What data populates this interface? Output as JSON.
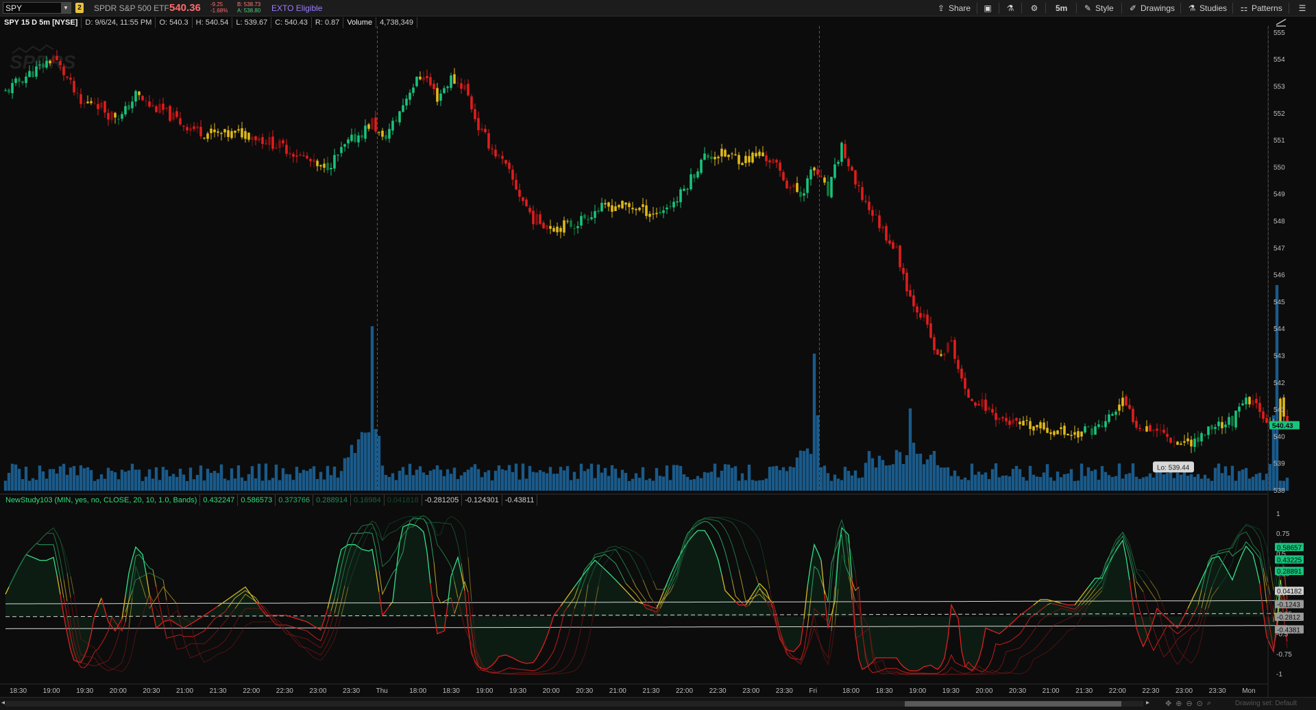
{
  "toolbar": {
    "symbol": "SPY",
    "link_badge": "2",
    "description": "SPDR S&P 500 ETF",
    "last_price": "540.36",
    "net_change": "-9.25",
    "pct_change": "-1.68%",
    "bid": "B: 538.73",
    "ask": "A: 538.80",
    "exto": "EXTO Eligible",
    "buttons": {
      "share": "Share",
      "timeframe": "5m",
      "style": "Style",
      "drawings": "Drawings",
      "studies": "Studies",
      "patterns": "Patterns"
    },
    "icons": [
      "share-icon",
      "notes-icon",
      "flask-icon",
      "gear-icon",
      "style-icon",
      "drawings-icon",
      "studies-icon",
      "patterns-icon",
      "menu-icon"
    ]
  },
  "chart_info": {
    "title": "SPY 15 D 5m [NYSE]",
    "date": "D: 9/6/24, 11:55 PM",
    "open": "O: 540.3",
    "high": "H: 540.54",
    "low": "L: 539.67",
    "close": "C: 540.43",
    "range": "R: 0.87",
    "volume_label": "Volume",
    "volume_value": "4,738,349"
  },
  "price_axis": {
    "ticks": [
      "555",
      "554",
      "553",
      "552",
      "551",
      "550",
      "549",
      "548",
      "547",
      "546",
      "545",
      "544",
      "543",
      "542",
      "541",
      "540",
      "539",
      "538"
    ],
    "current_price_tag": "540.43",
    "low_label": "Lo: 539.44"
  },
  "study": {
    "name": "NewStudy103 (MIN, yes, no, CLOSE, 20, 10, 1.0, Bands)",
    "values": [
      "0.432247",
      "0.586573",
      "0.373766",
      "0.288914",
      "0.16984",
      "0.041818",
      "-0.281205",
      "-0.124301",
      "-0.43811"
    ],
    "axis_ticks": [
      "1",
      "0.75",
      "0.5",
      "0.25",
      "0",
      "-0.25",
      "-0.5",
      "-0.75",
      "-1"
    ],
    "tags": [
      "0.58657",
      "0.43225",
      "0.28891",
      "0.04182",
      "-0.1243",
      "-0.2812",
      "-0.4381"
    ]
  },
  "time_axis": {
    "labels": [
      "18:30",
      "19:00",
      "19:30",
      "20:00",
      "20:30",
      "21:00",
      "21:30",
      "22:00",
      "22:30",
      "23:00",
      "23:30",
      "Thu",
      "18:00",
      "18:30",
      "19:00",
      "19:30",
      "20:00",
      "20:30",
      "21:00",
      "21:30",
      "22:00",
      "22:30",
      "23:00",
      "23:30",
      "Fri",
      "18:00",
      "18:30",
      "19:00",
      "19:30",
      "20:00",
      "20:30",
      "21:00",
      "21:30",
      "22:00",
      "22:30",
      "23:00",
      "23:30",
      "Mon"
    ]
  },
  "footer": {
    "drawing_set": "Drawing set: Default"
  },
  "colors": {
    "up_strong": "#19c37d",
    "up_weak": "#0f7a3c",
    "down_strong": "#e11d1d",
    "down_weak": "#8a1010",
    "neutral": "#e0b81a",
    "volume": "#1a5a8a",
    "accent_last": "#ff6b6b"
  },
  "chart_data": {
    "type": "candlestick",
    "symbol": "SPY",
    "aggregation": "5m",
    "ylim": [
      538,
      555.2
    ],
    "price_path": [
      [
        0,
        552.8
      ],
      [
        6,
        553.4
      ],
      [
        10,
        553.7
      ],
      [
        14,
        554.1
      ],
      [
        18,
        553.3
      ],
      [
        22,
        552.3
      ],
      [
        26,
        552.5
      ],
      [
        30,
        552.0
      ],
      [
        34,
        551.9
      ],
      [
        38,
        552.7
      ],
      [
        42,
        552.3
      ],
      [
        46,
        552.1
      ],
      [
        52,
        551.6
      ],
      [
        58,
        551.3
      ],
      [
        64,
        551.2
      ],
      [
        70,
        551.3
      ],
      [
        76,
        551.0
      ],
      [
        82,
        550.7
      ],
      [
        88,
        550.3
      ],
      [
        92,
        549.9
      ],
      [
        96,
        550.3
      ],
      [
        100,
        550.9
      ],
      [
        104,
        551.3
      ],
      [
        107,
        551.7
      ],
      [
        110,
        551.0
      ],
      [
        114,
        551.8
      ],
      [
        118,
        552.9
      ],
      [
        122,
        553.5
      ],
      [
        126,
        552.6
      ],
      [
        130,
        553.3
      ],
      [
        134,
        553.0
      ],
      [
        138,
        551.5
      ],
      [
        142,
        550.7
      ],
      [
        146,
        550.0
      ],
      [
        150,
        549.0
      ],
      [
        154,
        548.1
      ],
      [
        160,
        547.8
      ],
      [
        166,
        547.9
      ],
      [
        172,
        548.4
      ],
      [
        178,
        548.6
      ],
      [
        184,
        548.5
      ],
      [
        190,
        548.3
      ],
      [
        196,
        548.8
      ],
      [
        200,
        549.6
      ],
      [
        204,
        550.4
      ],
      [
        208,
        550.5
      ],
      [
        212,
        550.4
      ],
      [
        216,
        550.3
      ],
      [
        220,
        550.5
      ],
      [
        224,
        550.2
      ],
      [
        228,
        549.4
      ],
      [
        232,
        549.0
      ],
      [
        236,
        550.0
      ],
      [
        240,
        549.0
      ],
      [
        244,
        550.8
      ],
      [
        248,
        549.3
      ],
      [
        252,
        548.5
      ],
      [
        256,
        547.7
      ],
      [
        260,
        546.9
      ],
      [
        264,
        545.2
      ],
      [
        268,
        544.4
      ],
      [
        272,
        542.9
      ],
      [
        276,
        543.5
      ],
      [
        280,
        541.6
      ],
      [
        284,
        541.3
      ],
      [
        290,
        540.7
      ],
      [
        296,
        540.4
      ],
      [
        304,
        540.3
      ],
      [
        312,
        540.1
      ],
      [
        320,
        540.4
      ],
      [
        326,
        541.3
      ],
      [
        330,
        540.5
      ],
      [
        336,
        540.3
      ],
      [
        342,
        539.8
      ],
      [
        348,
        539.9
      ],
      [
        352,
        540.4
      ],
      [
        358,
        540.6
      ],
      [
        362,
        541.3
      ],
      [
        366,
        541.1
      ],
      [
        370,
        540.2
      ],
      [
        372,
        541.3
      ],
      [
        374,
        540.4
      ]
    ],
    "series": [
      {
        "name": "Volume",
        "type": "bar",
        "note": "spikes at session opens Thu and Fri"
      }
    ]
  }
}
